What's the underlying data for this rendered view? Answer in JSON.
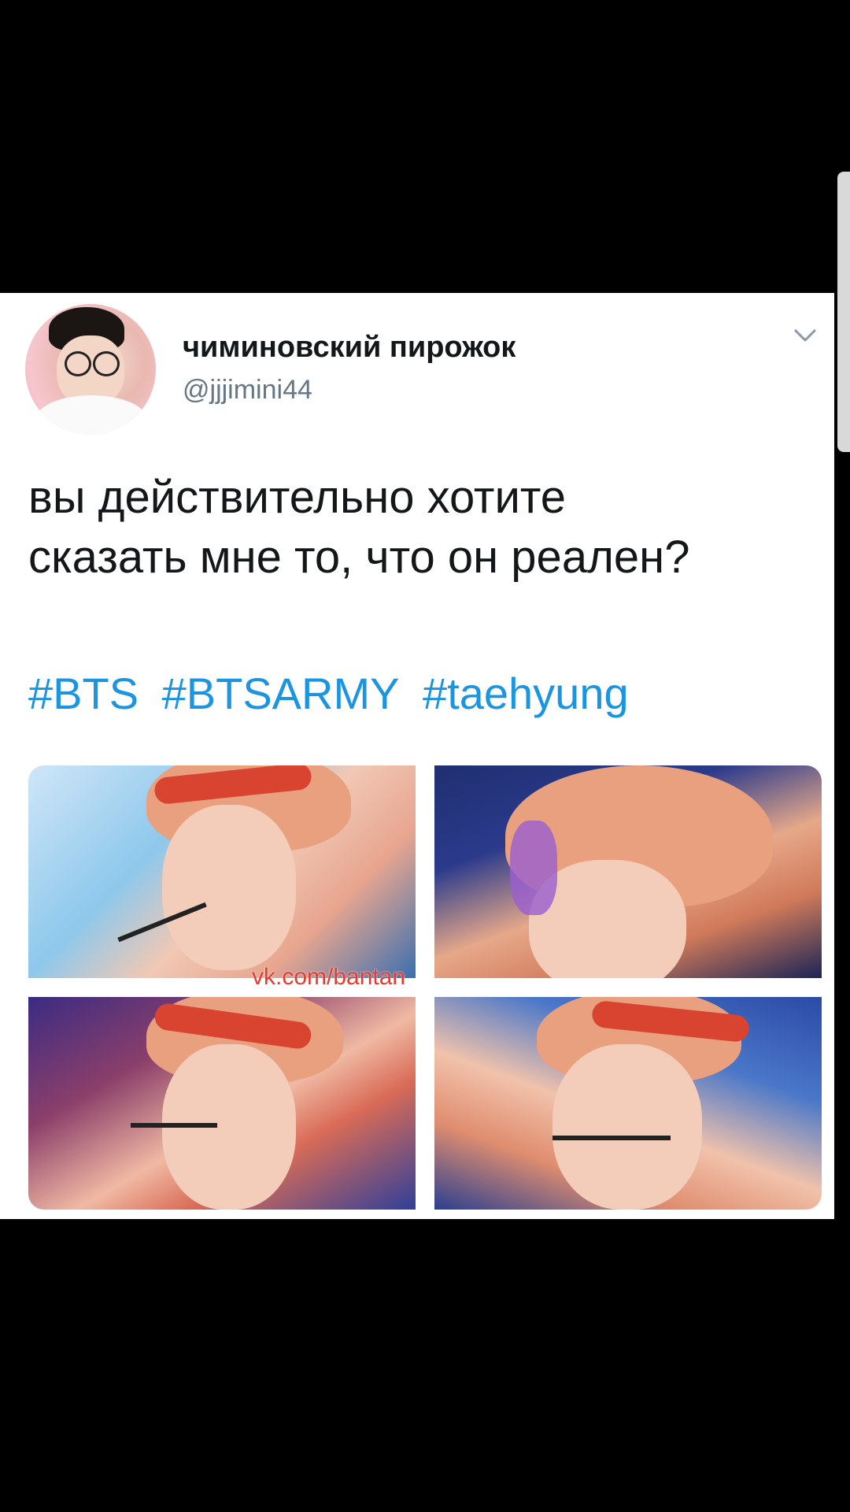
{
  "tweet": {
    "display_name": "чиминовский пирожок",
    "handle": "@jjjimini44",
    "text_line1": "вы действительно хотите",
    "text_line2": "сказать мне то, что он реален?",
    "hashtags": [
      "#BTS",
      "#BTSARMY",
      "#taehyung"
    ],
    "watermark": "vk.com/bantan"
  },
  "icons": {
    "menu": "chevron-down-icon"
  },
  "colors": {
    "hashtag": "#1b95e0",
    "name": "#14171a",
    "handle": "#657786",
    "watermark": "#e63a2e"
  }
}
